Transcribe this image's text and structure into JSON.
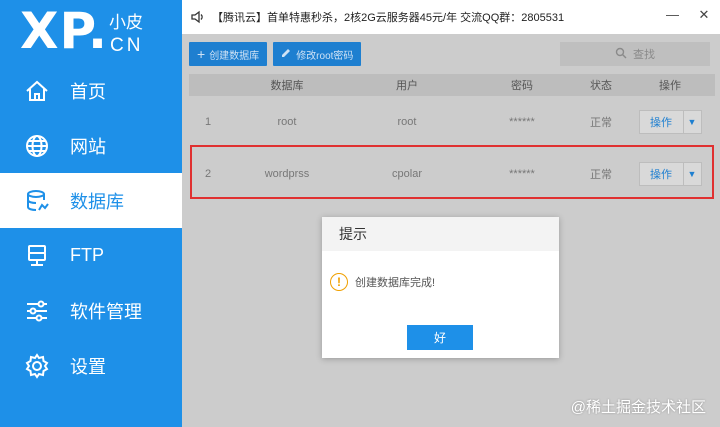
{
  "logo": {
    "main": "XP.",
    "top": "小皮",
    "bottom": "CN"
  },
  "sidebar": {
    "items": [
      {
        "label": "首页",
        "icon": "home-icon"
      },
      {
        "label": "网站",
        "icon": "globe-icon"
      },
      {
        "label": "数据库",
        "icon": "database-icon",
        "active": true
      },
      {
        "label": "FTP",
        "icon": "server-icon"
      },
      {
        "label": "软件管理",
        "icon": "sliders-icon"
      },
      {
        "label": "设置",
        "icon": "gear-icon"
      }
    ]
  },
  "topbar": {
    "announcement": "【腾讯云】首单特惠秒杀，2核2G云服务器45元/年 交流QQ群：2805531",
    "minimize": "—",
    "close": "✕"
  },
  "toolbar": {
    "create_db": "创建数据库",
    "change_root_pwd": "修改root密码",
    "search_placeholder": "查找"
  },
  "table": {
    "headers": [
      "",
      "数据库",
      "用户",
      "密码",
      "状态",
      "操作"
    ],
    "rows": [
      {
        "idx": "1",
        "db": "root",
        "user": "root",
        "pwd": "******",
        "status": "正常",
        "op": "操作"
      },
      {
        "idx": "2",
        "db": "wordprss",
        "user": "cpolar",
        "pwd": "******",
        "status": "正常",
        "op": "操作"
      }
    ]
  },
  "dialog": {
    "title": "提示",
    "message": "创建数据库完成!",
    "ok": "好"
  },
  "watermark": "@稀土掘金技术社区",
  "colors": {
    "accent": "#1e90e8",
    "highlight": "#e03030",
    "warning": "#f0a000"
  }
}
